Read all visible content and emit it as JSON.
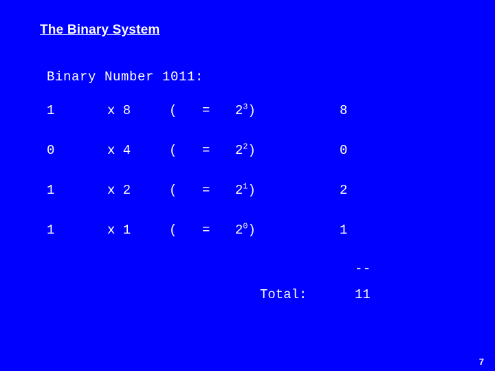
{
  "slide": {
    "title": "The Binary System",
    "subtitle": "Binary Number 1011:",
    "background_color": "#0000FF",
    "text_color": "#FFFFFF",
    "page_number": "7"
  },
  "rows": [
    {
      "bit": "1",
      "times": "x 8",
      "paren_open": "(",
      "equals": "=",
      "base": "2",
      "exponent": "3",
      "paren_close": ")",
      "result": "8"
    },
    {
      "bit": "0",
      "times": "x 4",
      "paren_open": "(",
      "equals": "=",
      "base": "2",
      "exponent": "2",
      "paren_close": ")",
      "result": "0"
    },
    {
      "bit": "1",
      "times": "x 2",
      "paren_open": "(",
      "equals": "=",
      "base": "2",
      "exponent": "1",
      "paren_close": ")",
      "result": "2"
    },
    {
      "bit": "1",
      "times": "x 1",
      "paren_open": "(",
      "equals": "=",
      "base": "2",
      "exponent": "0",
      "paren_close": ")",
      "result": "1"
    }
  ],
  "totals": {
    "rule": "--",
    "label": "Total:",
    "value": "11"
  }
}
